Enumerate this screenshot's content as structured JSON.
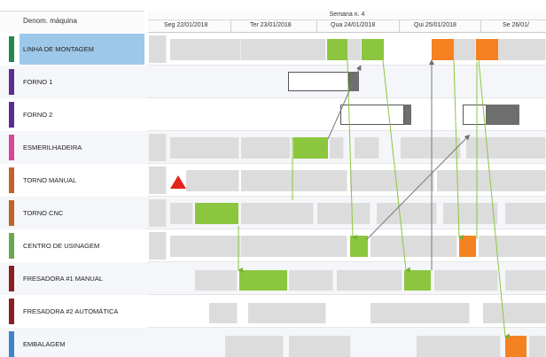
{
  "header": {
    "machine_column_label": "Denom. máquina",
    "week_label": "Semana n. 4",
    "days": [
      "Seg 22/01/2018",
      "Ter 23/01/2018",
      "Qua 24/01/2018",
      "Qui 25/01/2018",
      "Se 26/01/"
    ]
  },
  "machines": [
    {
      "name": "LINHA DE MONTAGEM",
      "color": "#1f8a4c",
      "selected": true
    },
    {
      "name": "FORNO 1",
      "color": "#5b2d91"
    },
    {
      "name": "FORNO 2",
      "color": "#5b2d91"
    },
    {
      "name": "ESMERILHADEIRA",
      "color": "#d6479b"
    },
    {
      "name": "TORNO MANUAL",
      "color": "#c0622b"
    },
    {
      "name": "TORNO CNC",
      "color": "#c0622b"
    },
    {
      "name": "CENTRO DE USINAGEM",
      "color": "#6aa84f"
    },
    {
      "name": "FRESADORA #1 MANUAL",
      "color": "#8b1d24"
    },
    {
      "name": "FRESADORA #2 AUTOMÁTICA",
      "color": "#8b1d24"
    },
    {
      "name": "EMBALAGEM",
      "color": "#3d85c6"
    }
  ],
  "colors": {
    "task_green": "#8cc63f",
    "task_orange": "#f58220",
    "idle_gray": "#dcdcdc",
    "selection": "#9dc8ea",
    "warning": "#e3241b"
  },
  "icons": {
    "warning": "warning-triangle-icon"
  }
}
